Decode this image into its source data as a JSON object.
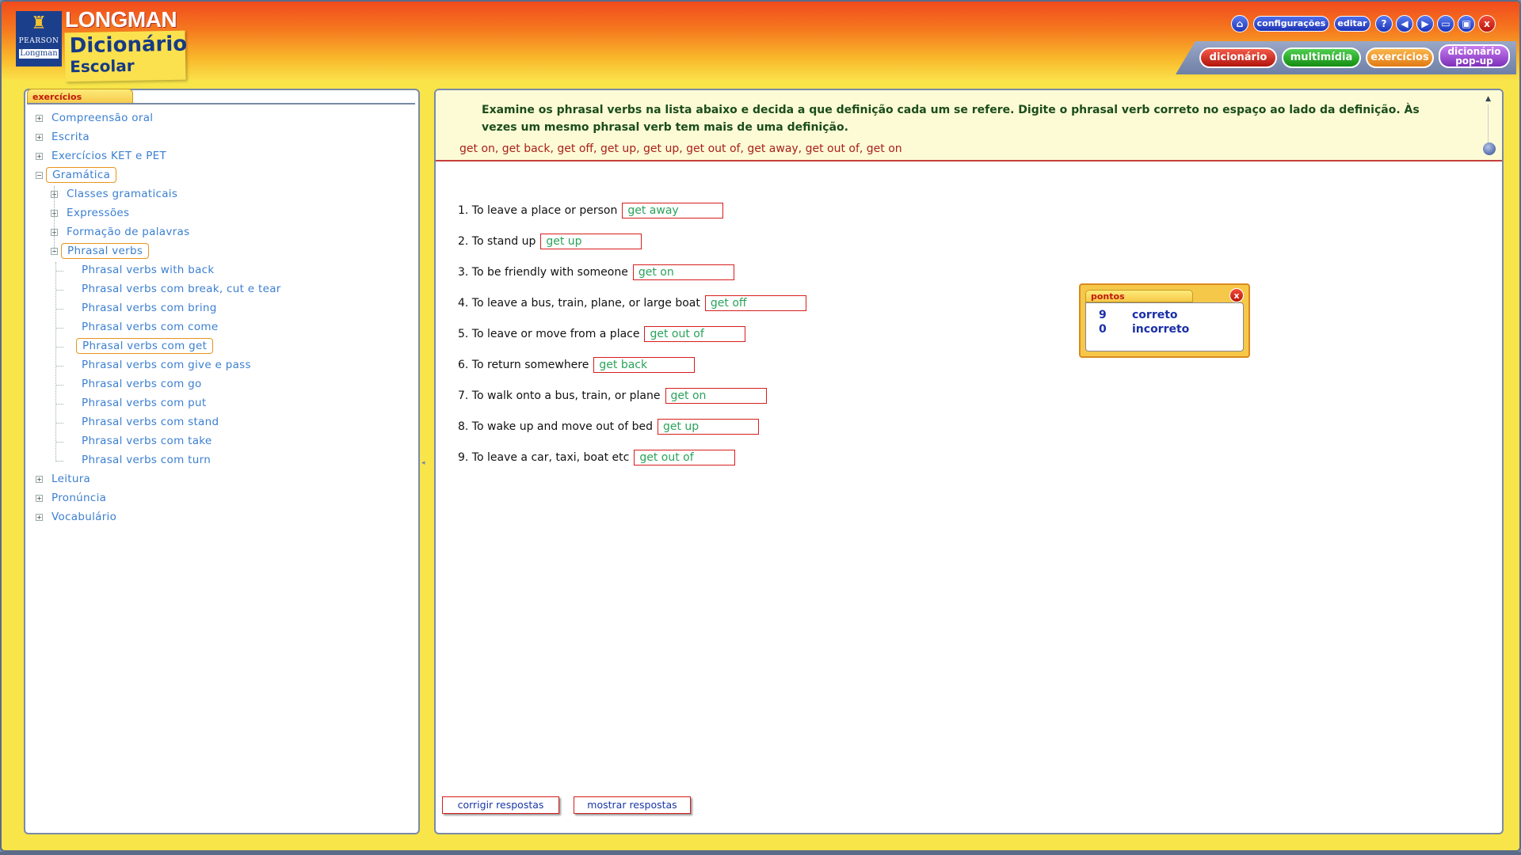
{
  "brand": {
    "pearson": "PEARSON",
    "longman_small": "Longman",
    "title_top": "LONGMAN",
    "title_main": "Dicionário",
    "title_sub": "Escolar"
  },
  "toolbar": {
    "configuracoes": "configurações",
    "editar": "editar",
    "help": "?",
    "close": "x"
  },
  "nav": {
    "dicionario": "dicionário",
    "multimidia": "multimídia",
    "exercicios": "exercícios",
    "popup_line1": "dicionário",
    "popup_line2": "pop-up"
  },
  "sidebar": {
    "tab": "exercícios",
    "items": [
      {
        "label": "Compreensão oral",
        "expander": "+"
      },
      {
        "label": "Escrita",
        "expander": "+"
      },
      {
        "label": "Exercícios KET e PET",
        "expander": "+"
      },
      {
        "label": "Gramática",
        "expander": "−"
      },
      {
        "label": "Classes gramaticais",
        "expander": "+"
      },
      {
        "label": "Expressões",
        "expander": "+"
      },
      {
        "label": "Formação de palavras",
        "expander": "+"
      },
      {
        "label": "Phrasal verbs",
        "expander": "−"
      },
      {
        "label": "Phrasal verbs with back"
      },
      {
        "label": "Phrasal verbs com break, cut e tear"
      },
      {
        "label": "Phrasal verbs com bring"
      },
      {
        "label": "Phrasal verbs com come"
      },
      {
        "label": "Phrasal verbs com get"
      },
      {
        "label": "Phrasal verbs com give e pass"
      },
      {
        "label": "Phrasal verbs com go"
      },
      {
        "label": "Phrasal verbs com put"
      },
      {
        "label": "Phrasal verbs com stand"
      },
      {
        "label": "Phrasal verbs com take"
      },
      {
        "label": "Phrasal verbs com turn"
      },
      {
        "label": "Leitura",
        "expander": "+"
      },
      {
        "label": "Pronúncia",
        "expander": "+"
      },
      {
        "label": "Vocabulário",
        "expander": "+"
      }
    ]
  },
  "exercise": {
    "instructions": "Examine os phrasal verbs na lista abaixo e decida a que definição cada um se refere. Digite o phrasal verb correto no espaço ao lado da definição. Às vezes um mesmo phrasal verb tem mais de uma definição.",
    "word_list": "get on, get back, get off, get up, get up, get out of, get away, get out of, get on",
    "questions": [
      {
        "text": "1. To leave a place or person",
        "answer": "get away"
      },
      {
        "text": "2. To stand up",
        "answer": "get up"
      },
      {
        "text": "3. To be friendly with someone",
        "answer": "get on"
      },
      {
        "text": "4. To leave a bus, train, plane, or large boat",
        "answer": "get off"
      },
      {
        "text": "5. To leave or move from a place",
        "answer": "get out of"
      },
      {
        "text": "6. To return somewhere",
        "answer": "get back"
      },
      {
        "text": "7. To walk onto a bus, train, or plane",
        "answer": "get on"
      },
      {
        "text": "8. To wake up and move out of bed",
        "answer": "get up"
      },
      {
        "text": "9. To leave a car, taxi, boat etc",
        "answer": "get out of"
      }
    ],
    "check_button": "corrigir respostas",
    "show_button": "mostrar respostas"
  },
  "score": {
    "tab": "pontos",
    "close": "x",
    "correct_count": "9",
    "correct_label": "correto",
    "incorrect_count": "0",
    "incorrect_label": "incorreto"
  }
}
